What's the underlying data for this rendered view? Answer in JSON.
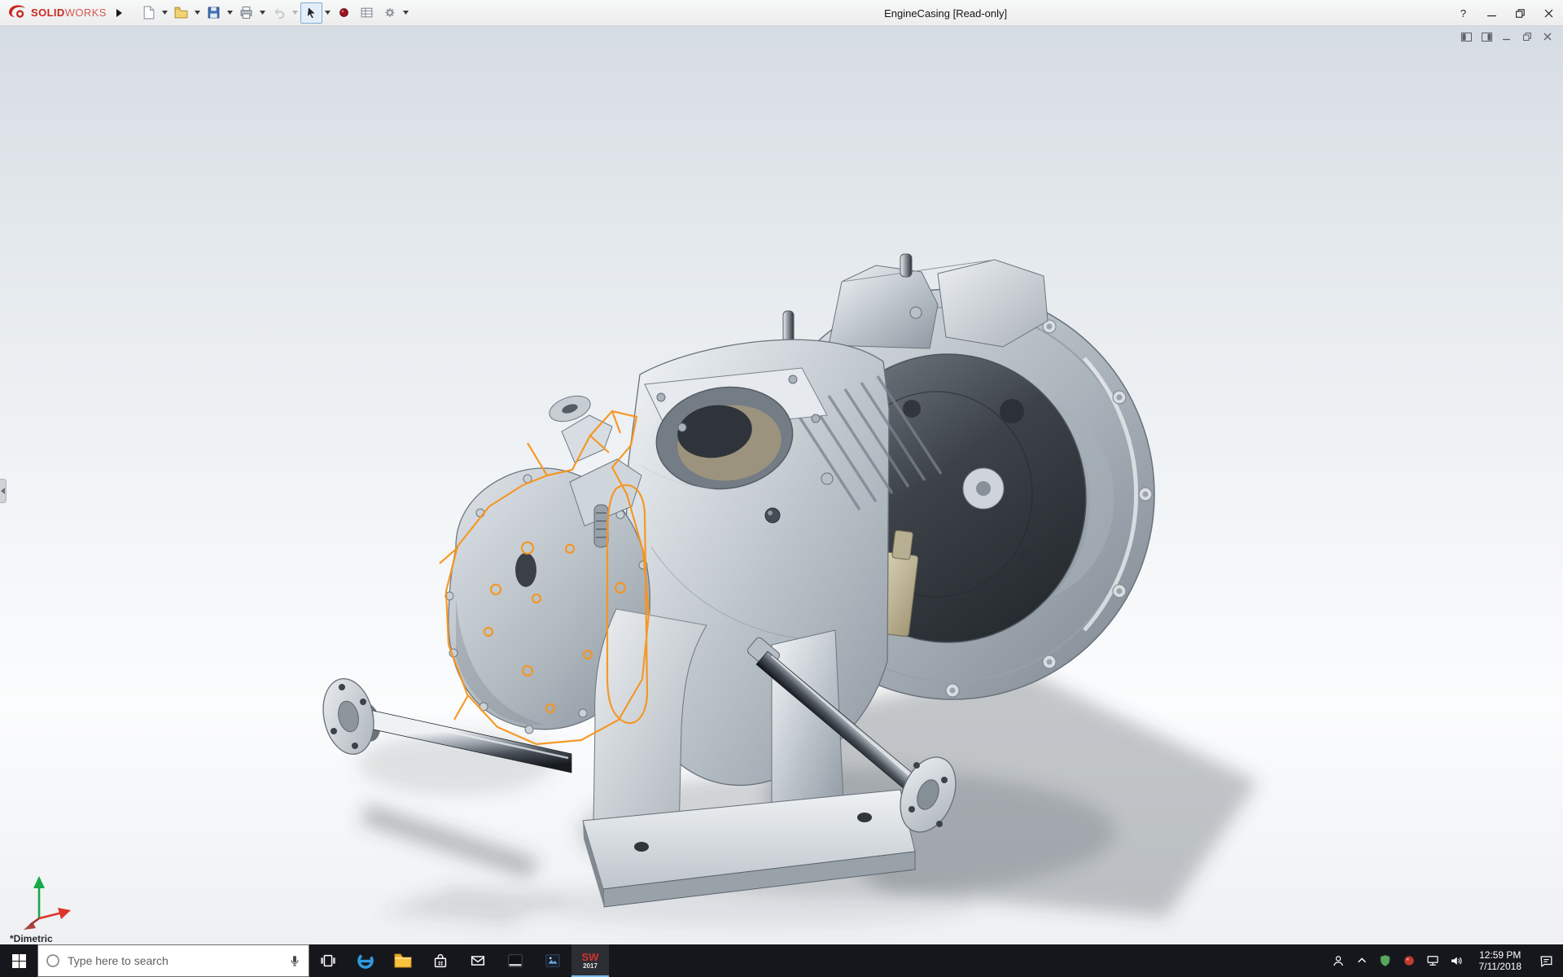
{
  "titlebar": {
    "logo": {
      "brand_bold": "SOLID",
      "brand_light": "WORKS"
    },
    "document_title": "EngineCasing [Read-only]",
    "help_glyph": "?",
    "window_controls": [
      "help",
      "minimize",
      "maximize",
      "close"
    ]
  },
  "toolbar": {
    "icons": [
      "new-document",
      "open",
      "save",
      "print",
      "undo",
      "select-arrow",
      "rebuild",
      "file-properties",
      "options"
    ],
    "active_tool": "select-arrow",
    "disabled_tools": [
      "undo"
    ]
  },
  "child_window_controls": [
    "dock-pane-left",
    "dock-pane-right",
    "minimize",
    "restore",
    "close"
  ],
  "viewport": {
    "view_orientation": "*Dimetric",
    "model": "engine-casing-assembly",
    "sketch_color": "#f7941d",
    "triad_colors": {
      "x_axis": "#de352c",
      "y_axis": "#18a94b",
      "z_axis": "#a3342c"
    }
  },
  "taskbar": {
    "search_placeholder": "Type here to search",
    "apps": [
      "task-view",
      "edge",
      "file-explorer",
      "store",
      "mail",
      "console",
      "photos",
      "solidworks"
    ],
    "active_app": "solidworks",
    "solidworks_badge": {
      "letters": "SW",
      "year": "2017"
    },
    "tray_icons": [
      "people",
      "chevron-up",
      "defender-shield",
      "resource-monitor",
      "network",
      "volume"
    ],
    "clock": {
      "time": "12:59 PM",
      "date": "7/11/2018"
    }
  },
  "colors": {
    "solidworks_red": "#c8281e",
    "sketch_orange": "#f7941d",
    "taskbar_bg": "#16171d",
    "edge_blue": "#2f9be0",
    "folder_yellow": "#f9c23c",
    "active_underline": "#76b9ed"
  }
}
